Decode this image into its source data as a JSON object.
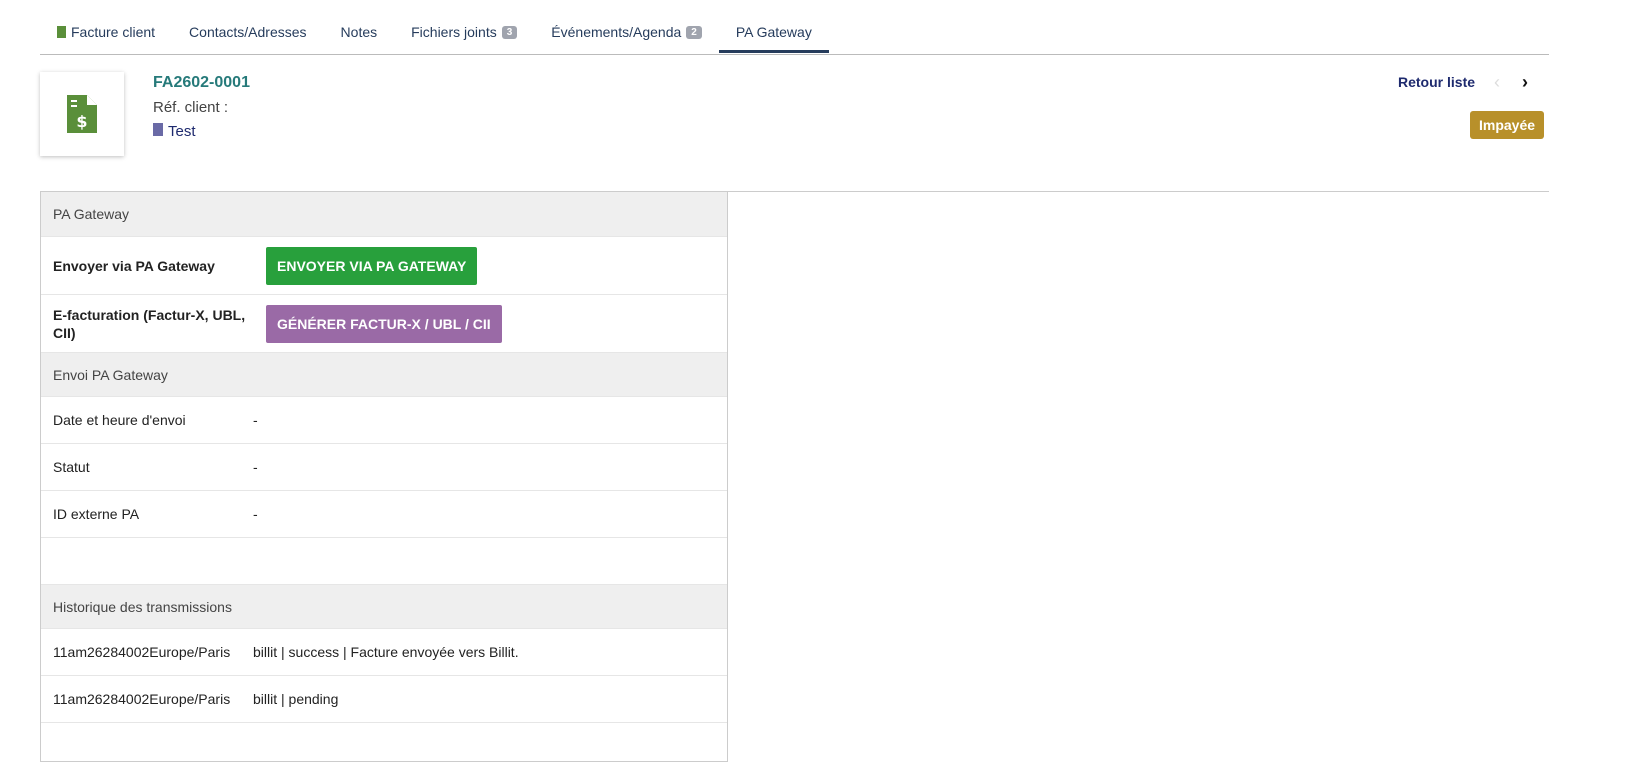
{
  "tabs": [
    {
      "label": "Facture client"
    },
    {
      "label": "Contacts/Adresses"
    },
    {
      "label": "Notes"
    },
    {
      "label": "Fichiers joints",
      "badge": "3"
    },
    {
      "label": "Événements/Agenda",
      "badge": "2"
    },
    {
      "label": "PA Gateway",
      "active": true
    }
  ],
  "header": {
    "ref": "FA2602-0001",
    "ref_client": "Réf. client :",
    "thirdparty": "Test",
    "back": "Retour liste",
    "status": "Impayée"
  },
  "colors": {
    "green_btn": "#28a03c",
    "purple_btn": "#9a6aa6",
    "status": "#b8902a"
  },
  "panel": {
    "title": "PA Gateway",
    "send_label": "Envoyer via PA Gateway",
    "send_button": "ENVOYER VIA PA GATEWAY",
    "einv_label": "E-facturation (Factur-X, UBL, CII)",
    "einv_button": "GÉNÉRER FACTUR-X / UBL / CII",
    "envoi_title": "Envoi PA Gateway",
    "fields": [
      {
        "label": "Date et heure d'envoi",
        "value": "-"
      },
      {
        "label": "Statut",
        "value": "-"
      },
      {
        "label": "ID externe PA",
        "value": "-"
      }
    ],
    "history_title": "Historique des transmissions",
    "history": [
      {
        "date": "11am26284002Europe/Paris",
        "text": "billit | success | Facture envoyée vers Billit."
      },
      {
        "date": "11am26284002Europe/Paris",
        "text": "billit | pending"
      }
    ]
  }
}
